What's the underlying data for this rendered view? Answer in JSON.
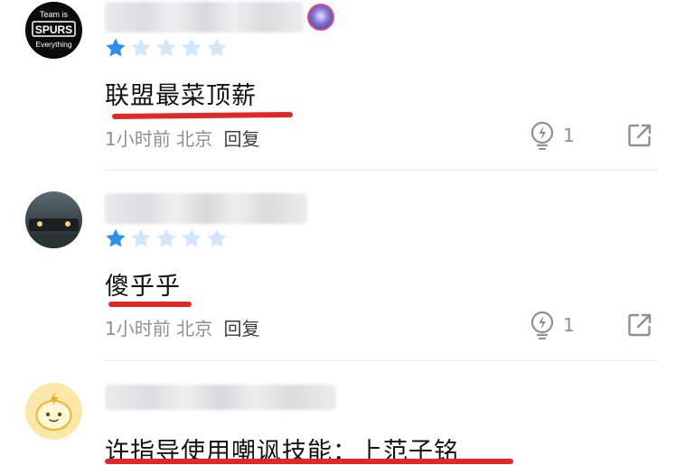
{
  "comments": [
    {
      "avatar_text": [
        "Team is",
        "SPURS",
        "Everything"
      ],
      "rating": 1,
      "max_rating": 5,
      "text": "联盟最菜顶薪",
      "time": "1小时前",
      "location": "北京",
      "reply_label": "回复",
      "likes": "1"
    },
    {
      "rating": 1,
      "max_rating": 5,
      "text": "傻乎乎",
      "time": "1小时前",
      "location": "北京",
      "reply_label": "回复",
      "likes": "1"
    },
    {
      "text": "许指导使用嘲讽技能：上范子铭"
    }
  ],
  "icons": {
    "star_filled": "star-filled-icon",
    "star_empty": "star-empty-icon",
    "like": "lightbulb-like-icon",
    "share": "share-icon"
  },
  "colors": {
    "star_filled": "#2b8ff0",
    "star_empty": "#cfe6fb",
    "underline": "#e02828",
    "meta": "#8a8f99"
  }
}
